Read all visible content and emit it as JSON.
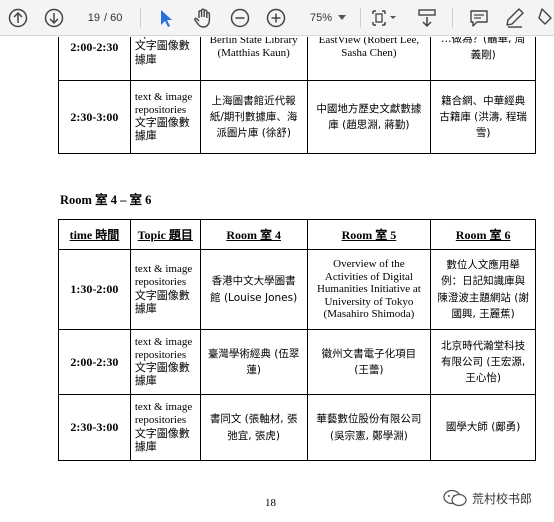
{
  "toolbar": {
    "page_current": "19",
    "page_total": "/ 60",
    "zoom": "75%"
  },
  "table_top": {
    "rows": [
      {
        "time": "2:00-2:30",
        "topic": "repositories 文字圖像數據庫",
        "room4": "Berlin State Library (Matthias Kaun)",
        "room5": "EastView (Robert Lee, Sasha Chen)",
        "room6": "…做為？(聶華, 周義剛)"
      },
      {
        "time": "2:30-3:00",
        "topic": "text & image repositories 文字圖像數據庫",
        "room4": "上海圖書館近代報紙/期刊數據庫、海派圖片庫 (徐舒)",
        "room5": "中國地方歷史文獻數據庫 (趙思淵, 蔣勤)",
        "room6": "籍合網、中華經典古籍庫 (洪濤, 程瑞雪)"
      }
    ]
  },
  "section_heading": "Room 室 4 – 室 6",
  "table_bottom": {
    "headers": [
      "time 時間",
      "Topic 題目",
      "Room 室 4",
      "Room 室 5",
      "Room 室 6"
    ],
    "rows": [
      {
        "time": "1:30-2:00",
        "topic": "text & image repositories 文字圖像數據庫",
        "room4": "香港中文大學圖書館 (Louise Jones)",
        "room5": "Overview of the Activities of Digital Humanities Initiative at University of Tokyo (Masahiro Shimoda)",
        "room6": "數位人文應用舉例：日記知識庫與陳澄波主題網站 (謝國興, 王麗蕉)"
      },
      {
        "time": "2:00-2:30",
        "topic": "text & image repositories 文字圖像數據庫",
        "room4": "臺灣學術經典 (伍翠蓮)",
        "room5": "徽州文書電子化項目 (王蕾)",
        "room6": "北京時代瀚堂科技有限公司 (王宏源, 王心怡)"
      },
      {
        "time": "2:30-3:00",
        "topic": "text & image repositories 文字圖像數據庫",
        "room4": "書同文 (張軸材, 張弛宜, 張虎)",
        "room5": "華藝數位股份有限公司 (吳宗憲, 鄭學淵)",
        "room6": "國學大師 (鄺勇)"
      }
    ]
  },
  "page_number": "18",
  "watermark": "荒村校书郎"
}
